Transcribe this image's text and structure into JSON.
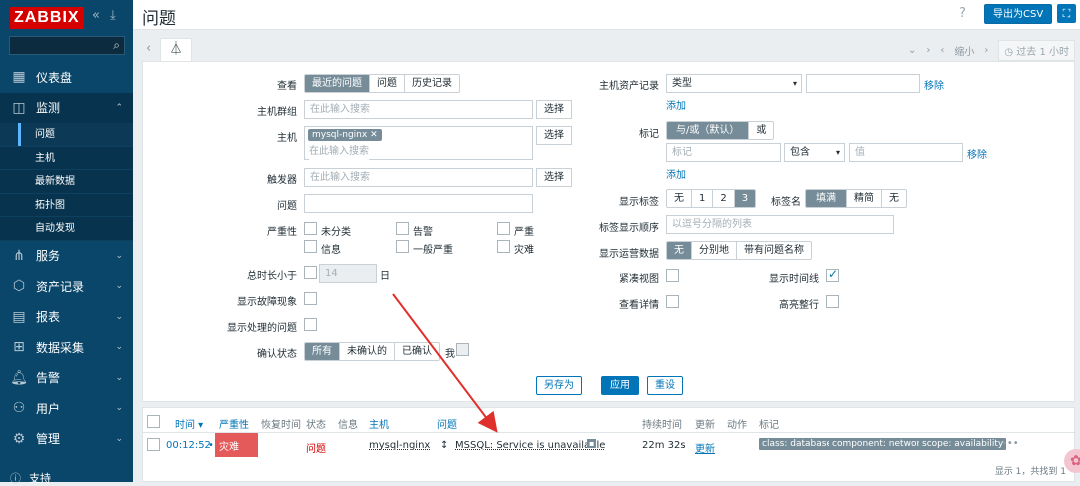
{
  "sidebar": {
    "logo": "ZABBIX",
    "collapse_icon": "«",
    "kiosk_icon": "⤓",
    "search_value": "",
    "items": [
      {
        "icon": "dashboard-icon",
        "label": "仪表盘"
      },
      {
        "icon": "monitoring-icon",
        "label": "监测"
      },
      {
        "icon": "services-icon",
        "label": "服务"
      },
      {
        "icon": "inventory-icon",
        "label": "资产记录"
      },
      {
        "icon": "reports-icon",
        "label": "报表"
      },
      {
        "icon": "data-collection-icon",
        "label": "数据采集"
      },
      {
        "icon": "alerts-icon",
        "label": "告警"
      },
      {
        "icon": "users-icon",
        "label": "用户"
      },
      {
        "icon": "admin-icon",
        "label": "管理"
      }
    ],
    "submenu": [
      "问题",
      "主机",
      "最新数据",
      "拓扑图",
      "自动发现"
    ],
    "support": "支持"
  },
  "header": {
    "title": "问题",
    "help": "?",
    "export_label": "导出为CSV",
    "fullscreen": "⛶"
  },
  "timenav": {
    "zoom_out": "缩小",
    "period": "过去 1 小时"
  },
  "filter": {
    "show_label": "查看",
    "show_options": [
      "最近的问题",
      "问题",
      "历史记录"
    ],
    "host_groups_label": "主机群组",
    "host_groups_placeholder": "在此输入搜索",
    "select_label": "选择",
    "hosts_label": "主机",
    "host_chip": "mysql-nginx",
    "hosts_placeholder": "在此输入搜索",
    "triggers_label": "触发器",
    "triggers_placeholder": "在此输入搜索",
    "problem_label": "问题",
    "severity_label": "严重性",
    "severities": [
      "未分类",
      "告警",
      "严重",
      "信息",
      "一般严重",
      "灾难"
    ],
    "age_label": "总时长小于",
    "age_value": "14",
    "age_unit": "日",
    "show_symptoms_label": "显示故障现象",
    "show_suppressed_label": "显示处理的问题",
    "ack_label": "确认状态",
    "ack_options": [
      "所有",
      "未确认的",
      "已确认"
    ],
    "ack_me": "我",
    "inventory_label": "主机资产记录",
    "inventory_field": "类型",
    "remove_label": "移除",
    "add_label": "添加",
    "tags_label": "标记",
    "tags_operator": [
      "与/或（默认）",
      "或"
    ],
    "tag_placeholder": "标记",
    "tag_op": "包含",
    "tag_value_placeholder": "值",
    "show_tags_label": "显示标签",
    "show_tags_options": [
      "无",
      "1",
      "2",
      "3"
    ],
    "tag_name_label": "标签名",
    "tag_name_options": [
      "填满",
      "精简",
      "无"
    ],
    "tag_priority_label": "标签显示顺序",
    "tag_priority_placeholder": "以逗号分隔的列表",
    "opdata_label": "显示运营数据",
    "opdata_options": [
      "无",
      "分别地",
      "带有问题名称"
    ],
    "compact_label": "紧凑视图",
    "timeline_label": "显示时间线",
    "details_label": "查看详情",
    "highlight_label": "高亮整行",
    "save_as": "另存为",
    "apply": "应用",
    "reset": "重设"
  },
  "table": {
    "headers": [
      "时间 ▾",
      "严重性",
      "恢复时间",
      "状态",
      "信息",
      "主机",
      "问题",
      "持续时间",
      "更新",
      "动作",
      "标记"
    ],
    "row": {
      "time": "00:12:52",
      "severity": "灾难",
      "status": "问题",
      "host": "mysql-nginx",
      "problem": "MSSQL: Service is unavailable",
      "duration": "22m 32s",
      "update": "更新",
      "tags": [
        "class: database",
        "component: network",
        "scope: availability"
      ],
      "more": "•••"
    },
    "footer": "显示 1，共找到 1"
  },
  "colors": {
    "accent": "#0275b8",
    "sidebar": "#0a466a",
    "disaster": "#e45959",
    "annotation_arrow": "#e0302b"
  }
}
